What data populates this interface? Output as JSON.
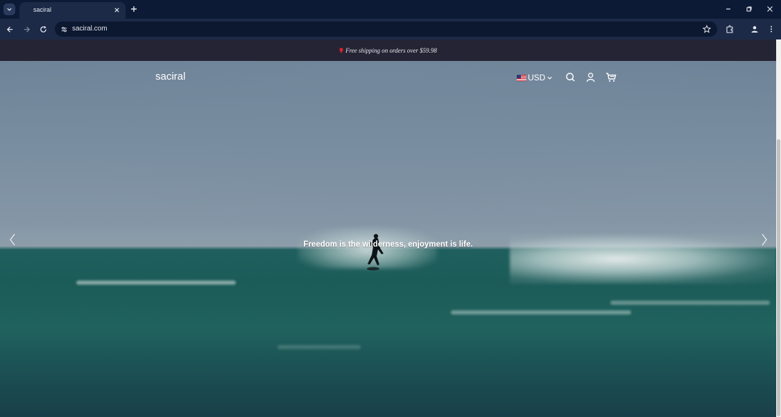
{
  "browser": {
    "tab_title": "saciral",
    "url": "saciral.com"
  },
  "announcement": {
    "text": "Free shipping on orders over $59.98"
  },
  "header": {
    "logo": "saciral",
    "currency": "USD"
  },
  "hero": {
    "caption": "Freedom is the wilderness, enjoyment is life."
  }
}
